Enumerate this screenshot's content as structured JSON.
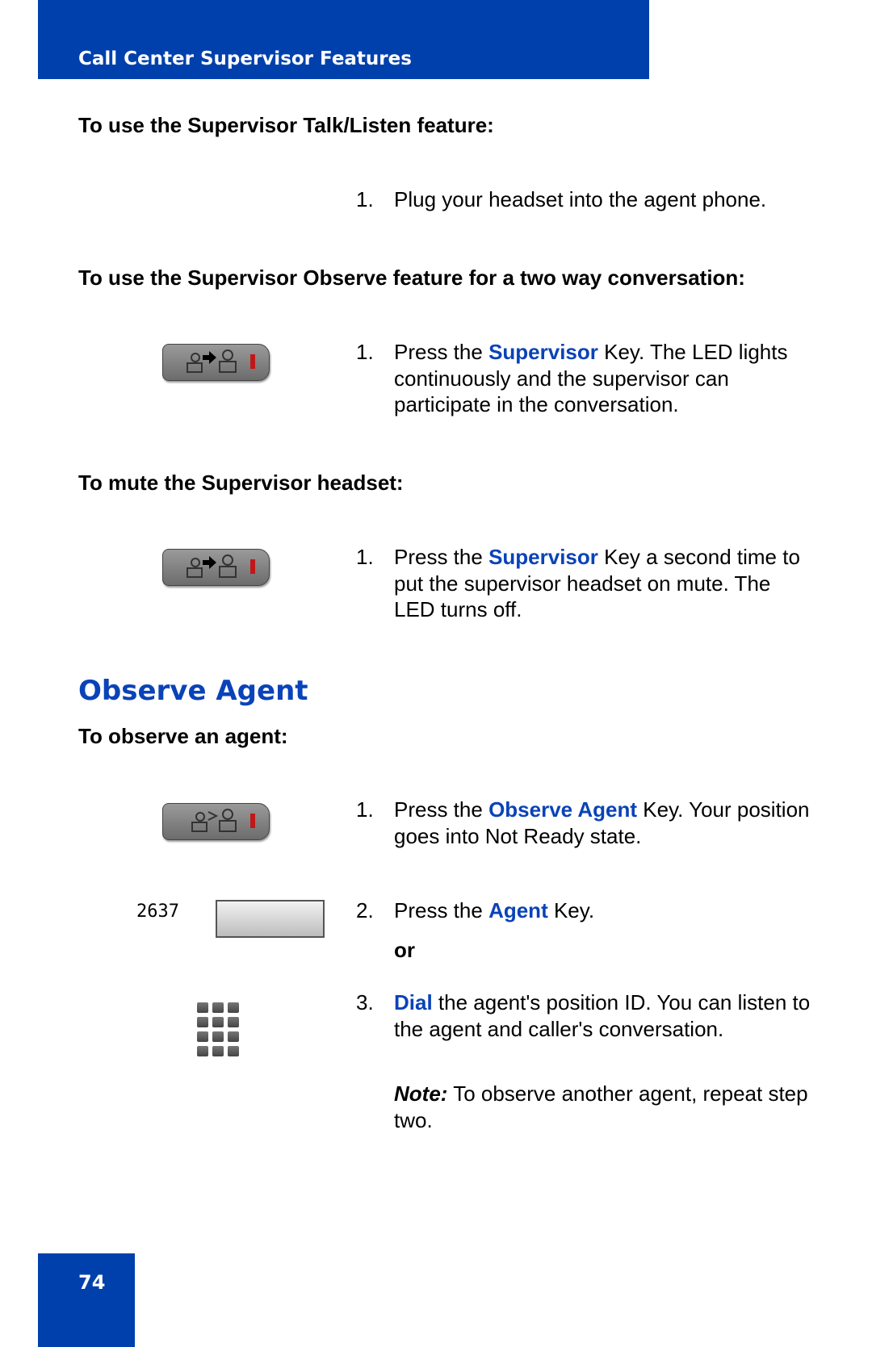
{
  "header": {
    "title": "Call Center Supervisor Features"
  },
  "sections": {
    "talk_listen": {
      "heading": "To use the Supervisor Talk/Listen feature:",
      "step1_num": "1.",
      "step1": "Plug your headset into the agent phone."
    },
    "observe_two_way": {
      "heading": "To use the Supervisor Observe feature for a two way conversation:",
      "step1_num": "1.",
      "pre": "Press the ",
      "key": "Supervisor",
      "post": " Key. The LED lights continuously and the supervisor can participate in the conversation."
    },
    "mute": {
      "heading": "To mute the Supervisor headset:",
      "step1_num": "1.",
      "pre": "Press the ",
      "key": "Supervisor",
      "post": " Key a second time to put the supervisor headset on mute. The LED turns off."
    }
  },
  "observe_agent": {
    "title": "Observe Agent",
    "heading": "To observe an agent:",
    "step1": {
      "num": "1.",
      "pre": "Press the ",
      "key": "Observe Agent",
      "post": " Key. Your position goes into Not Ready state."
    },
    "step2": {
      "num": "2.",
      "pre": "Press the ",
      "key": "Agent",
      "post": " Key.",
      "agent_id": "2637"
    },
    "or": "or",
    "step3": {
      "num": "3.",
      "key": "Dial",
      "post": " the agent's position ID. You can listen to the agent and caller's conversation."
    },
    "note_label": "Note:",
    "note": " To observe another agent, repeat step two."
  },
  "footer": {
    "page_number": "74"
  },
  "colors": {
    "brand": "#0040ad",
    "highlight": "#0a43b8",
    "led": "#c01818"
  }
}
